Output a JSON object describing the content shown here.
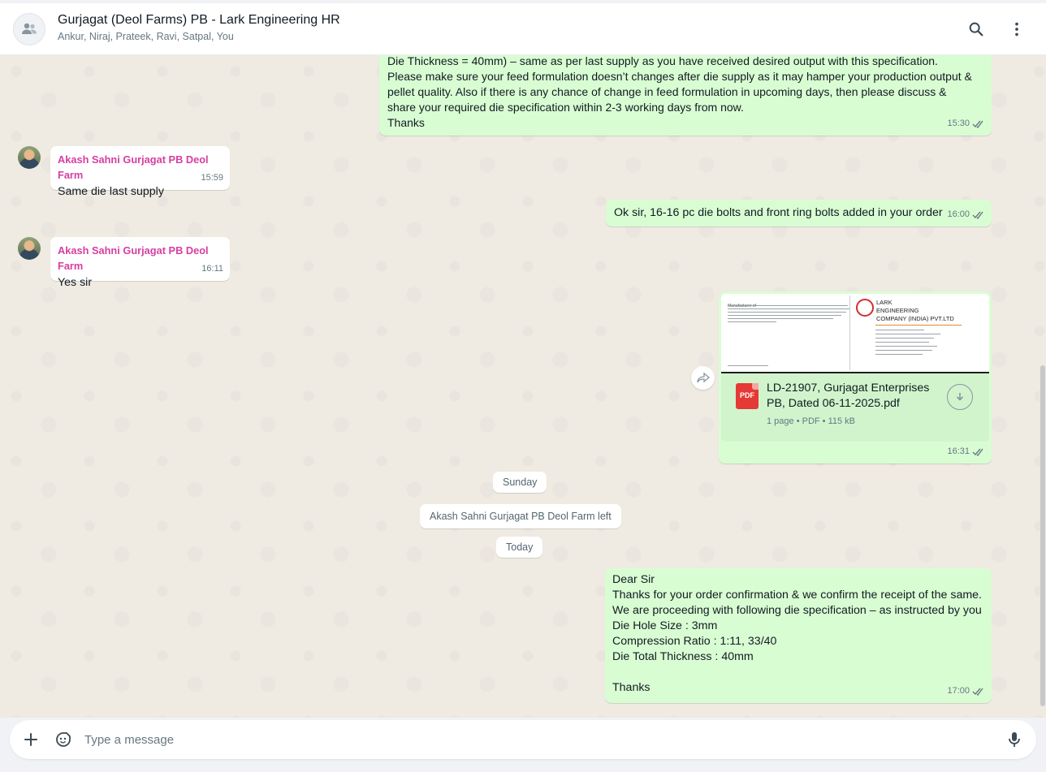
{
  "header": {
    "title": "Gurjagat (Deol Farms) PB - Lark Engineering HR",
    "participants": "Ankur, Niraj, Prateek, Ravi, Satpal, You",
    "search_icon": "search-icon",
    "menu_icon": "kebab-menu-icon"
  },
  "messages": {
    "m1": {
      "lines": "Die Thickness = 40mm) – same as per last supply as you have received desired output with this specification.\nPlease make sure your feed formulation doesn’t changes after die supply as it may hamper your production output &\npellet quality. Also if there is any chance of change in feed formulation in upcoming days, then please discuss &\nshare your required die specification within 2-3 working days from now.\nThanks",
      "time": "15:30"
    },
    "m2": {
      "sender": "Akash Sahni Gurjagat PB Deol Farm",
      "text": "Same die last supply",
      "time": "15:59"
    },
    "m3": {
      "text": "Ok sir, 16-16 pc die bolts and front ring bolts added in your order",
      "time": "16:00"
    },
    "m4": {
      "sender": "Akash Sahni Gurjagat PB Deol Farm",
      "text": "Yes sir",
      "time": "16:11"
    },
    "m5": {
      "preview_company": "LARK\nENGINEERING\nCOMPANY (INDIA) PVT.LTD",
      "preview_manufacturer": "Manufacturer of",
      "pdf_label": "PDF",
      "filename": "LD-21907, Gurjagat Enterprises PB, Dated 06-11-2025.pdf",
      "info": "1 page • PDF • 115 kB",
      "time": "16:31"
    },
    "sys1": "Sunday",
    "sys2": "Akash Sahni Gurjagat PB Deol Farm left",
    "sys3": "Today",
    "m6": {
      "lines": "Dear Sir\nThanks for your order confirmation & we confirm the receipt of the same.\nWe are proceeding with following die specification – as instructed by you\nDie Hole Size : 3mm\nCompression Ratio : 1:11, 33/40\nDie Total Thickness : 40mm\n\nThanks",
      "time": "17:00"
    }
  },
  "composer": {
    "placeholder": "Type a message",
    "attach_icon": "plus-icon",
    "sticker_icon": "sticker-icon",
    "mic_icon": "microphone-icon"
  },
  "colors": {
    "outgoing": "#d9fdd3",
    "incoming": "#ffffff",
    "sender_name": "#d73ea1",
    "read_ticks": "#667781",
    "chat_background": "#efeae2"
  }
}
